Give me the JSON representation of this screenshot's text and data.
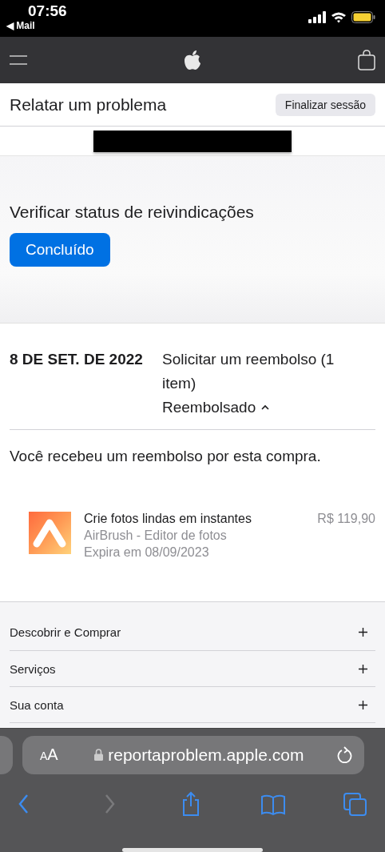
{
  "status_bar": {
    "time": "07:56",
    "back_app": "◀ Mail"
  },
  "page_header": {
    "title": "Relatar um problema",
    "sign_out": "Finalizar sessão"
  },
  "claims": {
    "title": "Verificar status de reivindicações",
    "done_button": "Concluído"
  },
  "claim": {
    "date": "8 DE SET. DE 2022",
    "request": "Solicitar um reembolso (1 item)",
    "status": "Reembolsado",
    "expanded": true,
    "message": "Você recebeu um reembolso por esta compra.",
    "product": {
      "title": "Crie fotos lindas em instantes",
      "app": "AirBrush - Editor de fotos",
      "expiry": "Expira em 08/09/2023",
      "price": "R$ 119,90"
    }
  },
  "footer": {
    "sections": [
      {
        "label": "Descobrir e Comprar",
        "expanded": false
      },
      {
        "label": "Serviços",
        "expanded": false
      },
      {
        "label": "Sua conta",
        "expanded": false
      }
    ]
  },
  "browser": {
    "text_size": "AA",
    "url": "reportaproblem.apple.com",
    "toolbar": [
      {
        "kind": "back",
        "disabled": false
      },
      {
        "kind": "forward",
        "disabled": true
      },
      {
        "kind": "share",
        "disabled": false
      },
      {
        "kind": "bookmarks",
        "disabled": false
      },
      {
        "kind": "tabs",
        "disabled": false
      }
    ]
  }
}
